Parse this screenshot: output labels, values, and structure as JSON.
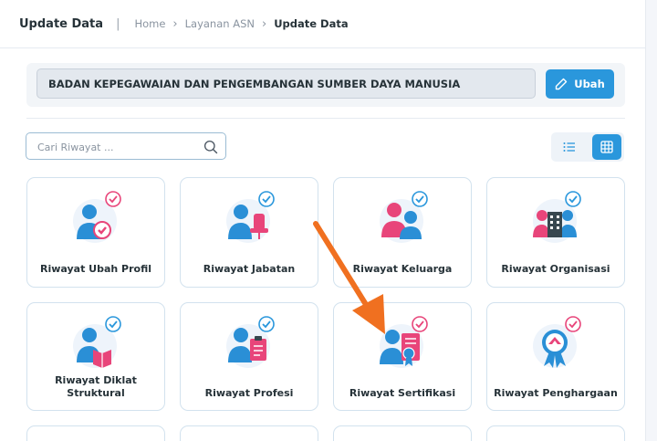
{
  "header": {
    "title": "Update Data",
    "separator": "|",
    "breadcrumb": [
      "Home",
      "Layanan ASN",
      "Update Data"
    ]
  },
  "org": {
    "name": "BADAN KEPEGAWAIAN DAN PENGEMBANGAN SUMBER DAYA MANUSIA",
    "edit_label": "Ubah"
  },
  "search": {
    "placeholder": "Cari Riwayat ..."
  },
  "view_mode": "grid",
  "colors": {
    "accent": "#2a97dc",
    "person_blue": "#2a8fd6",
    "pink": "#e8457a",
    "arrow": "#f07020"
  },
  "cards": [
    {
      "label": "Riwayat Ubah Profil",
      "icon": "person-heart-icon"
    },
    {
      "label": "Riwayat Jabatan",
      "icon": "person-chair-icon"
    },
    {
      "label": "Riwayat Keluarga",
      "icon": "family-icon"
    },
    {
      "label": "Riwayat Organisasi",
      "icon": "organization-icon"
    },
    {
      "label": "Riwayat Diklat Struktural",
      "icon": "person-book-icon"
    },
    {
      "label": "Riwayat Profesi",
      "icon": "person-briefcase-icon"
    },
    {
      "label": "Riwayat Sertifikasi",
      "icon": "person-certificate-icon"
    },
    {
      "label": "Riwayat Penghargaan",
      "icon": "award-medal-icon"
    }
  ]
}
